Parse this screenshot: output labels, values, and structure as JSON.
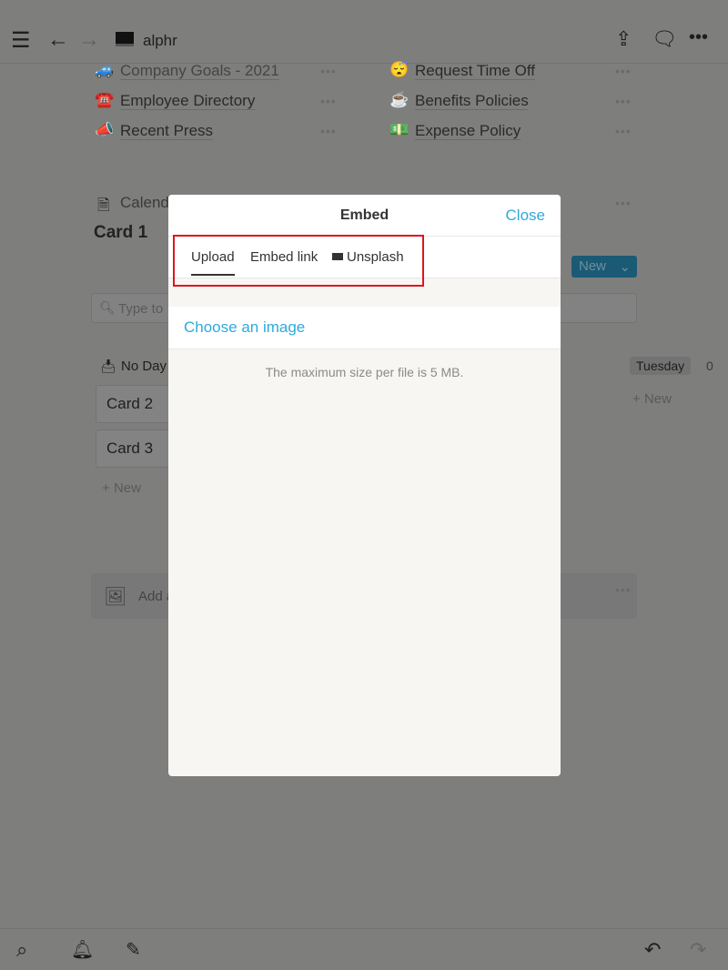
{
  "topbar": {
    "title": "alphr",
    "icons": [
      "menu-icon",
      "back-arrow-icon",
      "forward-arrow-icon",
      "laptop-icon",
      "share-icon",
      "comment-icon",
      "more-icon"
    ]
  },
  "links": [
    {
      "emoji": "🚙",
      "label": "Company Goals - 2021"
    },
    {
      "emoji": "😴",
      "label": "Request Time Off"
    },
    {
      "emoji": "☎️",
      "label": "Employee Directory"
    },
    {
      "emoji": "☕",
      "label": "Benefits Policies"
    },
    {
      "emoji": "📣",
      "label": "Recent Press"
    },
    {
      "emoji": "💵",
      "label": "Expense Policy"
    }
  ],
  "page": {
    "calendar_label": "Calend",
    "card_title": "Card 1",
    "new_button": "New",
    "search_placeholder": "Type to",
    "no_day": "No Day",
    "tuesday": "Tuesday",
    "tuesday_count": "0",
    "cards": [
      "Card 2",
      "Card 3"
    ],
    "add_new": "New",
    "add_cover": "Add a"
  },
  "modal": {
    "title": "Embed",
    "close": "Close",
    "tabs": [
      "Upload",
      "Embed link",
      "Unsplash"
    ],
    "active_tab": "Upload",
    "choose": "Choose an image",
    "note": "The maximum size per file is 5 MB."
  },
  "colors": {
    "accent": "#2eaadc",
    "highlight": "#e0141e"
  }
}
